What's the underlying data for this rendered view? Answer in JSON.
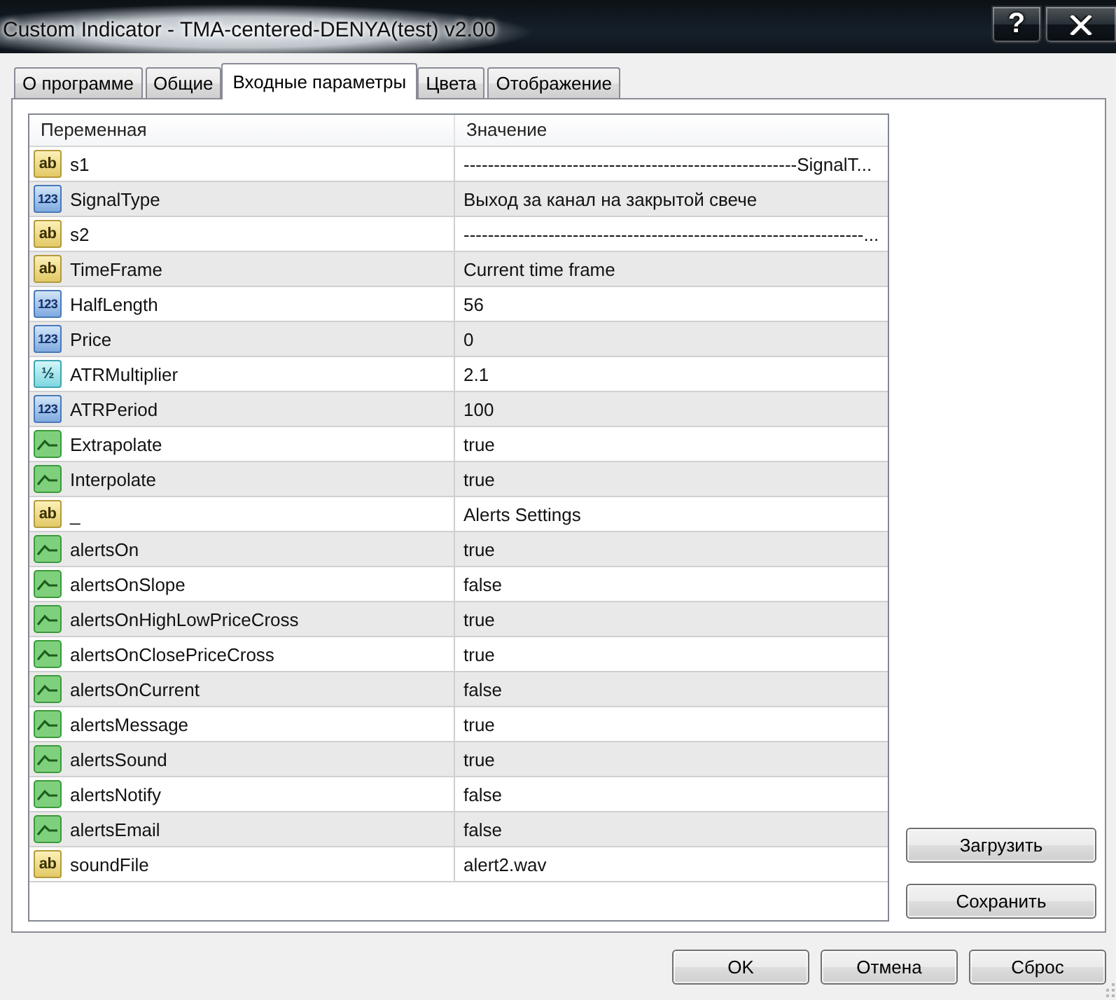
{
  "window": {
    "title": "Custom Indicator - TMA-centered-DENYA(test) v2.00",
    "help_button": "?"
  },
  "tabs": [
    {
      "label": "О программе",
      "selected": false
    },
    {
      "label": "Общие",
      "selected": false
    },
    {
      "label": "Входные параметры",
      "selected": true
    },
    {
      "label": "Цвета",
      "selected": false
    },
    {
      "label": "Отображение",
      "selected": false
    }
  ],
  "table": {
    "columns": [
      "Переменная",
      "Значение"
    ],
    "rows": [
      {
        "kind": "string",
        "badge": "ab",
        "name": "s1",
        "value": "-------------------------------------------------------SignalT..."
      },
      {
        "kind": "int",
        "badge": "123",
        "name": "SignalType",
        "value": "Выход за канал на закрытой свече"
      },
      {
        "kind": "string",
        "badge": "ab",
        "name": "s2",
        "value": "------------------------------------------------------------------..."
      },
      {
        "kind": "string",
        "badge": "ab",
        "name": "TimeFrame",
        "value": "Current time frame"
      },
      {
        "kind": "int",
        "badge": "123",
        "name": "HalfLength",
        "value": "56"
      },
      {
        "kind": "int",
        "badge": "123",
        "name": "Price",
        "value": "0"
      },
      {
        "kind": "double",
        "badge": "½",
        "name": "ATRMultiplier",
        "value": "2.1"
      },
      {
        "kind": "int",
        "badge": "123",
        "name": "ATRPeriod",
        "value": "100"
      },
      {
        "kind": "bool",
        "name": "Extrapolate",
        "value": "true"
      },
      {
        "kind": "bool",
        "name": "Interpolate",
        "value": "true"
      },
      {
        "kind": "string",
        "badge": "ab",
        "name": "_",
        "value": "Alerts Settings"
      },
      {
        "kind": "bool",
        "name": "alertsOn",
        "value": "true"
      },
      {
        "kind": "bool",
        "name": "alertsOnSlope",
        "value": "false"
      },
      {
        "kind": "bool",
        "name": "alertsOnHighLowPriceCross",
        "value": "true"
      },
      {
        "kind": "bool",
        "name": "alertsOnClosePriceCross",
        "value": "true"
      },
      {
        "kind": "bool",
        "name": "alertsOnCurrent",
        "value": "false"
      },
      {
        "kind": "bool",
        "name": "alertsMessage",
        "value": "true"
      },
      {
        "kind": "bool",
        "name": "alertsSound",
        "value": "true"
      },
      {
        "kind": "bool",
        "name": "alertsNotify",
        "value": "false"
      },
      {
        "kind": "bool",
        "name": "alertsEmail",
        "value": "false"
      },
      {
        "kind": "string",
        "badge": "ab",
        "name": "soundFile",
        "value": "alert2.wav"
      }
    ]
  },
  "side_buttons": [
    "Загрузить",
    "Сохранить"
  ],
  "buttons": [
    "OK",
    "Отмена",
    "Сброс"
  ]
}
